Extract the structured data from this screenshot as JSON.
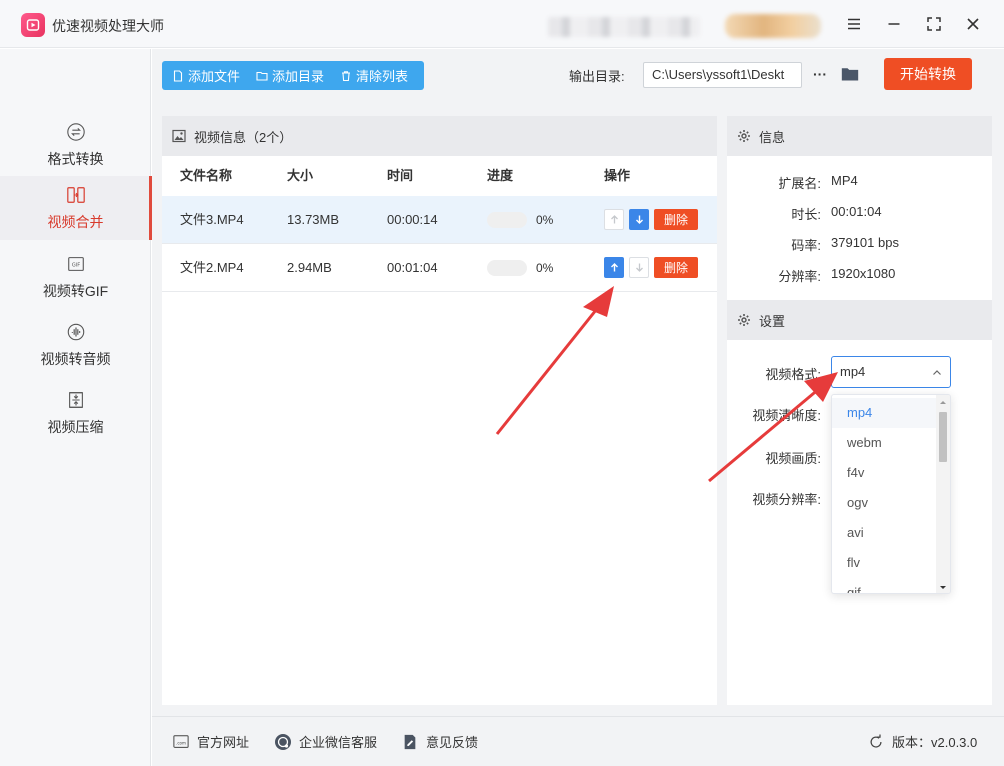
{
  "app": {
    "title": "优速视频处理大师"
  },
  "sidebar": {
    "items": [
      {
        "label": "格式转换",
        "icon": "format-convert-icon"
      },
      {
        "label": "视频合并",
        "icon": "video-merge-icon",
        "active": true
      },
      {
        "label": "视频转GIF",
        "icon": "gif-icon"
      },
      {
        "label": "视频转音频",
        "icon": "audio-icon"
      },
      {
        "label": "视频压缩",
        "icon": "compress-icon"
      }
    ]
  },
  "toolbar": {
    "add_file": "添加文件",
    "add_folder": "添加目录",
    "clear_list": "清除列表",
    "output_label": "输出目录:",
    "output_path": "C:\\Users\\yssoft1\\Deskt",
    "more": "···",
    "start": "开始转换"
  },
  "video_list": {
    "header": "视频信息（2个）",
    "columns": [
      "文件名称",
      "大小",
      "时间",
      "进度",
      "操作"
    ],
    "rows": [
      {
        "name": "文件3.MP4",
        "size": "13.73MB",
        "duration": "00:00:14",
        "progress": 0,
        "progress_text": "0%",
        "delete": "删除"
      },
      {
        "name": "文件2.MP4",
        "size": "2.94MB",
        "duration": "00:01:04",
        "progress": 0,
        "progress_text": "0%",
        "delete": "删除"
      }
    ]
  },
  "info": {
    "header": "信息",
    "ext_label": "扩展名:",
    "ext": "MP4",
    "duration_label": "时长:",
    "duration": "00:01:04",
    "bitrate_label": "码率:",
    "bitrate": "379101 bps",
    "resolution_label": "分辨率:",
    "resolution": "1920x1080"
  },
  "settings": {
    "header": "设置",
    "format_label": "视频格式:",
    "format_value": "mp4",
    "clarity_label": "视频清晰度:",
    "quality_label": "视频画质:",
    "resolution_label": "视频分辨率:",
    "format_options": [
      "mp4",
      "webm",
      "f4v",
      "ogv",
      "avi",
      "flv",
      "gif"
    ]
  },
  "footer": {
    "website": "官方网址",
    "wechat": "企业微信客服",
    "feedback": "意见反馈",
    "version_label": "版本：v2.0.3.0"
  },
  "colors": {
    "accent_blue": "#3ea7ee",
    "primary_blue": "#3b86e8",
    "danger_red": "#ef4e24",
    "nav_active": "#d83a2c"
  }
}
